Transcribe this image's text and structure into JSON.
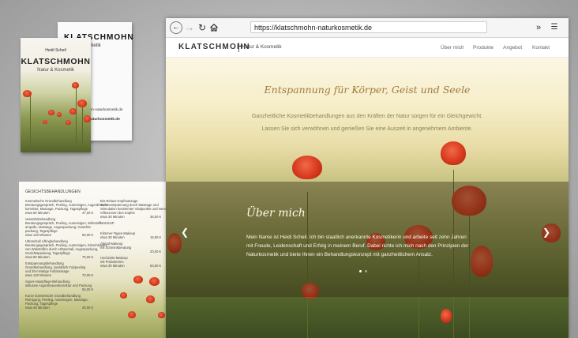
{
  "business_card": {
    "back": {
      "brand": "KLATSCHMOHN",
      "subtitle": "Natur & Kosmetik",
      "email": "info@klatschmohn-naturkosmetik.de",
      "website": "klatschmohn-naturkosmetik.de"
    },
    "front": {
      "name": "Heidi Scheil",
      "brand": "KLATSCHMOHN",
      "subtitle": "Natur & Kosmetik"
    }
  },
  "price_list": {
    "heading": "GESICHTSBEHANDLUNGEN",
    "left_col": [
      {
        "title": "Kosmetische Grundbehandlung",
        "desc": "Beratungsgespräch, Peeling, Ausreinigen, Augenbrauen-\nkorrektur, Massage, Packung, Tagespflege",
        "time": "etwa 60 Minuten",
        "price": "47,00 €"
      },
      {
        "title": "Verwöhnbehandlung",
        "desc": "Beratungsgespräch, Peeling, Ausreinigen, Wirkstoff-\nampulle, Massage, Augenpackung, Gesichts-\npackung, Tagespflege",
        "time": "etwa 120 Minuten",
        "price": "60,00 €"
      },
      {
        "title": "Ultraschall Liftingbehandlung",
        "desc": "Beratungsgespräch, Peeling, Ausreinigen, Einschleusen\nvon Wirkstoffen durch Ultraschall, Augenpackung,\nGesichtspackung, Tagespflege",
        "time": "etwa 90 Minuten",
        "price": "75,00 €"
      },
      {
        "title": "Entspannungsbehandlung",
        "desc": "Grundbehandlung, zusätzlich Fußpeeling\nund 30-minütige Fußmassage",
        "time": "etwa 120 Minuten",
        "price": "70,00 €"
      },
      {
        "title": "Super-Hautpflege-Behandlung",
        "desc": "inklusive Augenbrauenkorrektur und Packung",
        "time": "",
        "price": "55,00 €"
      },
      {
        "title": "Kurze kosmetische Grundbehandlung",
        "desc": "Reinigung, Peeling, Ausreinigen, Massage,\nPackung, Tagespflege",
        "time": "etwa 45 Minuten",
        "price": "40,00 €"
      }
    ],
    "right_col": [
      {
        "title": "Bio-Relaxe-Kopfmassage",
        "desc": "Tiefenentspannung durch Massage und\nStimulation bestimmter Vitalpunkte und Nerven-\nreflexzonen des Kopfes",
        "time": "etwa 30 Minuten",
        "price": "36,00 €"
      },
      {
        "title": "MAKEUP",
        "desc": "",
        "time": "",
        "price": ""
      },
      {
        "title": "Klimmer-Tages-Makeup",
        "desc": "",
        "time": "etwa 30 Minuten",
        "price": "15,00 €"
      },
      {
        "title": "Abend-Makeup",
        "desc": "mit Schminkberatung",
        "time": "",
        "price": "20,00 €"
      },
      {
        "title": "Hochzeits-Makeup",
        "desc": "mit Probetermin",
        "time": "etwa 30 Minuten",
        "price": "50,00 €"
      }
    ]
  },
  "browser": {
    "url": "https://klatschmohn-naturkosmetik.de",
    "back_icon": "back-arrow",
    "forward_icon": "forward-arrow",
    "reload_icon": "reload",
    "home_icon": "home",
    "overflow_icon": "double-chevron",
    "menu_icon": "hamburger"
  },
  "site": {
    "logo": "KLATSCHMOHN",
    "logo_sub": "Natur & Kosmetik",
    "nav": [
      "Über mich",
      "Produkte",
      "Angebot",
      "Kontakt"
    ],
    "tagline": "Entspannung für Körper, Geist und Seele",
    "intro_1": "Ganzheitliche Kosmetikbehandlungen aus den Kräften der Natur sorgen für ein Gleichgewicht.",
    "intro_2": "Lassen Sie sich verwöhnen und genießen Sie eine Auszeit in angenehmem Ambiente.",
    "section_title": "Über mich",
    "section_text": [
      "Mein Name ist Heidi Scheil. Ich bin staatlich anerkannte Kosmetikerin und arbeite seit zehn Jahren",
      "mit Freude, Leidenschaft und Erfolg in meinem Beruf. Dabei richte ich mich nach den Prinzipien der",
      "Naturkosmetik und biete Ihnen ein Behandlungskonzept mit ganzheitlichem Ansatz."
    ],
    "slider": {
      "total": 3,
      "active": 0
    },
    "colors": {
      "tagline": "#a07b3a",
      "poppy": "#d83a1e"
    }
  }
}
